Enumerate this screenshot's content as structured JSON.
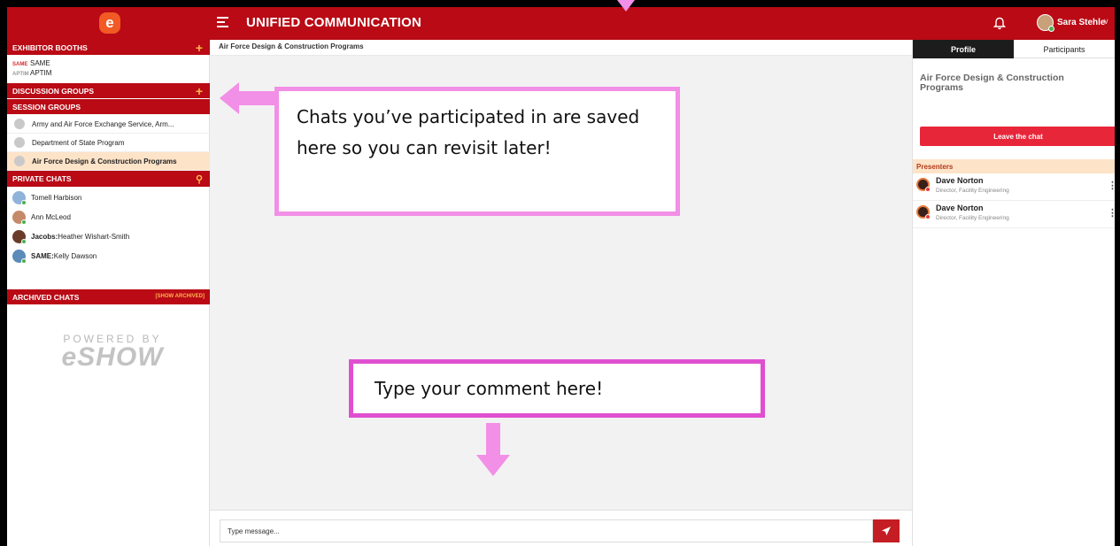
{
  "app": {
    "logo_letter": "e",
    "title": "UNIFIED COMMUNICATION",
    "user_name": "Sara Stehle",
    "brand_color": "#b90a15"
  },
  "sidebar": {
    "exhibitor_booths": {
      "header": "EXHIBITOR BOOTHS",
      "items": [
        {
          "logo": "SAME",
          "label": "SAME"
        },
        {
          "logo": "APTIM",
          "label": "APTIM"
        }
      ]
    },
    "discussion_groups": {
      "header": "DISCUSSION GROUPS"
    },
    "session_groups": {
      "header": "SESSION GROUPS",
      "items": [
        {
          "label": "Army and Air Force Exchange Service, Arm..."
        },
        {
          "label": "Department of State Program"
        },
        {
          "label": "Air Force Design & Construction Programs",
          "active": true
        }
      ]
    },
    "private_chats": {
      "header": "PRIVATE CHATS",
      "items": [
        {
          "prefix": "",
          "label": "Tomell Harbison"
        },
        {
          "prefix": "",
          "label": "Ann McLeod"
        },
        {
          "prefix": "Jacobs:",
          "label": "Heather Wishart-Smith"
        },
        {
          "prefix": "SAME:",
          "label": "Kelly Dawson"
        }
      ]
    },
    "archived_chats": {
      "header": "ARCHIVED CHATS",
      "show_label": "[SHOW ARCHIVED]"
    },
    "powered_by": {
      "line1": "POWERED BY",
      "line2": "eSHOW"
    }
  },
  "chat": {
    "title": "Air Force Design & Construction Programs",
    "input_placeholder": "Type message..."
  },
  "right_panel": {
    "tabs": [
      "Profile",
      "Participants"
    ],
    "active_tab": "Profile",
    "chat_name": "Air Force Design & Construction Programs",
    "leave_button": "Leave the chat",
    "presenters_header": "Presenters",
    "presenters": [
      {
        "name": "Dave Norton",
        "title": "Director, Facility Engineering"
      },
      {
        "name": "Dave Norton",
        "title": "Director, Facility Engineering"
      }
    ]
  },
  "annotations": {
    "callout_1": "Chats you’ve participated in are saved here so you can revisit later!",
    "callout_2": "Type your comment here!",
    "color": "#f28fe6"
  }
}
